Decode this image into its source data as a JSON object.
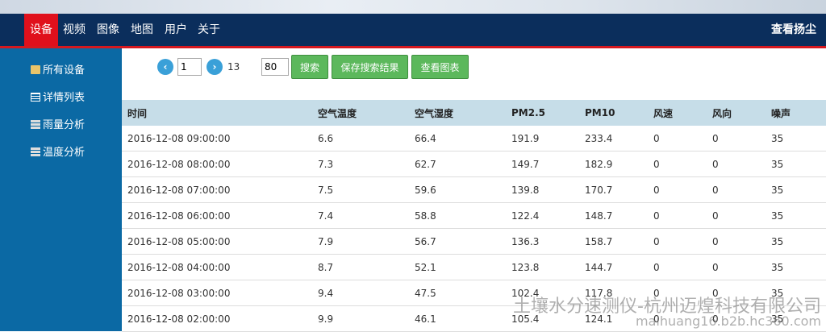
{
  "nav": {
    "items": [
      "设备",
      "视频",
      "图像",
      "地图",
      "用户",
      "关于"
    ],
    "active_index": 0,
    "right_link": "查看扬尘"
  },
  "colors": {
    "navbar": "#0b2e5c",
    "active": "#e0101c",
    "sidebar": "#0b69a4",
    "button": "#5cb85c",
    "header_row": "#c6dde8"
  },
  "sidebar": {
    "items": [
      {
        "label": "所有设备",
        "icon": "folder-icon"
      },
      {
        "label": "详情列表",
        "icon": "list-icon"
      },
      {
        "label": "雨量分析",
        "icon": "server-icon"
      },
      {
        "label": "温度分析",
        "icon": "server-icon"
      }
    ]
  },
  "toolbar": {
    "prev_glyph": "‹",
    "next_glyph": "›",
    "page_value": "1",
    "page_total": "13",
    "page_size": "80",
    "search_label": "搜索",
    "save_label": "保存搜索结果",
    "chart_label": "查看图表"
  },
  "table": {
    "columns": [
      "时间",
      "空气温度",
      "空气湿度",
      "PM2.5",
      "PM10",
      "风速",
      "风向",
      "噪声"
    ],
    "rows": [
      [
        "2016-12-08 09:00:00",
        "6.6",
        "66.4",
        "191.9",
        "233.4",
        "0",
        "0",
        "35"
      ],
      [
        "2016-12-08 08:00:00",
        "7.3",
        "62.7",
        "149.7",
        "182.9",
        "0",
        "0",
        "35"
      ],
      [
        "2016-12-08 07:00:00",
        "7.5",
        "59.6",
        "139.8",
        "170.7",
        "0",
        "0",
        "35"
      ],
      [
        "2016-12-08 06:00:00",
        "7.4",
        "58.8",
        "122.4",
        "148.7",
        "0",
        "0",
        "35"
      ],
      [
        "2016-12-08 05:00:00",
        "7.9",
        "56.7",
        "136.3",
        "158.7",
        "0",
        "0",
        "35"
      ],
      [
        "2016-12-08 04:00:00",
        "8.7",
        "52.1",
        "123.8",
        "144.7",
        "0",
        "0",
        "35"
      ],
      [
        "2016-12-08 03:00:00",
        "9.4",
        "47.5",
        "102.4",
        "117.8",
        "0",
        "0",
        "35"
      ],
      [
        "2016-12-08 02:00:00",
        "9.9",
        "46.1",
        "105.4",
        "124.1",
        "0",
        "0",
        "35"
      ]
    ]
  },
  "watermark": {
    "line1": "土壤水分速测仪-杭州迈煌科技有限公司",
    "line2": "maihuang16.b2b.hc360.com"
  }
}
